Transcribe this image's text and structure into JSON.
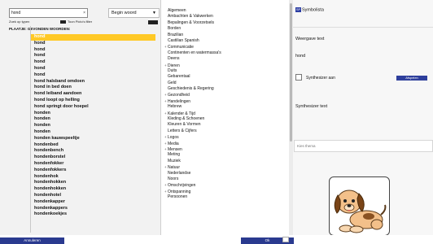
{
  "search": {
    "value": "hond",
    "clear_icon": "×"
  },
  "filter": {
    "selected": "Begin woord",
    "arrow": "▼"
  },
  "toggles": {
    "left_label": "Zoek op typen",
    "mid_label": "Toon Picto's filter"
  },
  "list_header": "PLAATJE:  GEVONDEN WOORDEN:",
  "words": [
    "hond",
    "hond",
    "hond",
    "hond",
    "hond",
    "hond",
    "hond",
    "hond halsband omdoen",
    "hond in bed doen",
    "hond leiband aandoen",
    "hond loopt op helling",
    "hond springt door hoepel",
    "honden",
    "honden",
    "honden",
    "honden",
    "honden kauwspeeltje",
    "hondenbed",
    "hondenbench",
    "hondenborstel",
    "hondenfokker",
    "hondenfokkers",
    "hondenhok",
    "hondenhokken",
    "hondenhokken",
    "hondenhotel",
    "hondenkapper",
    "hondenkappers",
    "hondenkoekjes"
  ],
  "selected_word_index": 0,
  "categories": [
    {
      "label": "Algemeen",
      "expand": false
    },
    {
      "label": "Ambachten & Vakwerken",
      "expand": false
    },
    {
      "label": "Bepalingen & Voorzetsels",
      "expand": false
    },
    {
      "label": "Borden",
      "expand": false
    },
    {
      "label": "Brazilian",
      "expand": false
    },
    {
      "label": "Castilian Spanish",
      "expand": false
    },
    {
      "label": "Communicatie",
      "expand": true
    },
    {
      "label": "Continenten en watermassa's",
      "expand": false
    },
    {
      "label": "Deens",
      "expand": false
    },
    {
      "label": "Dieren",
      "expand": true
    },
    {
      "label": "Duits",
      "expand": false
    },
    {
      "label": "Gebarentaal",
      "expand": false
    },
    {
      "label": "Geld",
      "expand": false
    },
    {
      "label": "Geschiedenis & Regering",
      "expand": false
    },
    {
      "label": "Gezondheid",
      "expand": true
    },
    {
      "label": "Handelingen",
      "expand": true
    },
    {
      "label": "Hebrew",
      "expand": false
    },
    {
      "label": "Kalender & Tijd",
      "expand": true
    },
    {
      "label": "Kleding & Schoenen",
      "expand": false
    },
    {
      "label": "Kleuren & Vormen",
      "expand": false
    },
    {
      "label": "Letters & Cijfers",
      "expand": false
    },
    {
      "label": "Logos",
      "expand": true
    },
    {
      "label": "Media",
      "expand": true
    },
    {
      "label": "Mensen",
      "expand": true
    },
    {
      "label": "Meting",
      "expand": false
    },
    {
      "label": "Muziek",
      "expand": false
    },
    {
      "label": "Natuur",
      "expand": true
    },
    {
      "label": "Nederlandse",
      "expand": false
    },
    {
      "label": "Noors",
      "expand": false
    },
    {
      "label": "Omschrijvingen",
      "expand": true
    },
    {
      "label": "Ontspanning",
      "expand": true
    },
    {
      "label": "Persoonen",
      "expand": false
    }
  ],
  "right": {
    "title": "Symbolista",
    "logo_text": "SP",
    "weergave_label": "Weergave text",
    "weergave_value": "hond",
    "synth_checkbox_label": "Synthesizer aan",
    "afspelen_label": "Afspelen",
    "synth_text_label": "Synthesizer text",
    "kies_placeholder": "Kies thema"
  },
  "buttons": {
    "cancel": "Annuleren",
    "ok": "Ok"
  },
  "colors": {
    "selected": "#ffc926",
    "button": "#2a3a8f"
  }
}
